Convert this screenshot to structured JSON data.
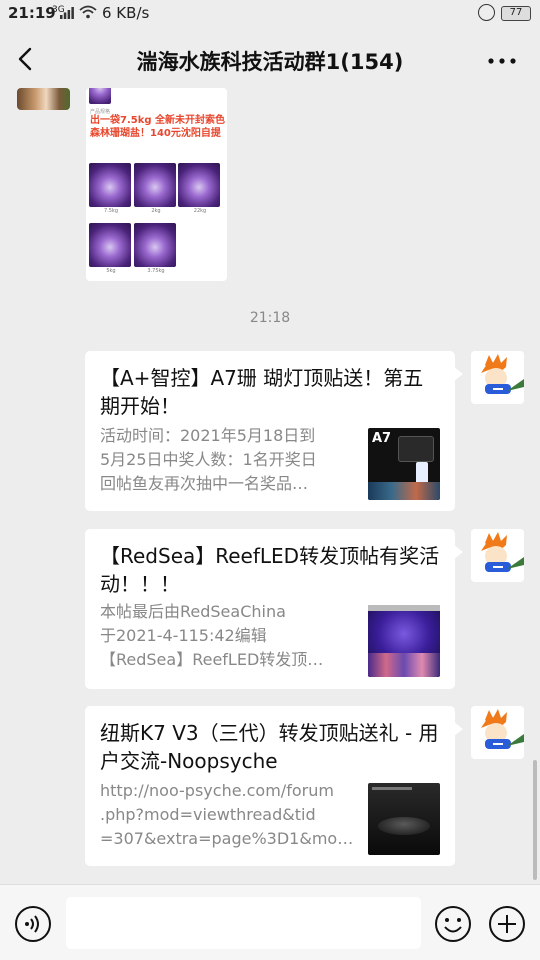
{
  "status_bar": {
    "time": "21:19",
    "network": "3G",
    "speed": "6 KB/s",
    "battery": "77"
  },
  "header": {
    "title": "湍海水族科技活动群1(154)"
  },
  "image_message": {
    "promo_text": "出一袋7.5kg 全新未开封索色森林珊瑚盐！140元沈阳自提",
    "small_text": "产品规格",
    "captions": [
      "7.5kg",
      "2kg",
      "22kg",
      "5kg",
      "3.75kg"
    ]
  },
  "timestamp": "21:18",
  "messages": [
    {
      "title": "【A+智控】A7珊 瑚灯顶贴送！第五期开始！",
      "description": "活动时间：2021年5月18日到\n5月25日中奖人数：1名开奖日\n回帖鱼友再次抽中一名奖品…",
      "thumb_label": "A7"
    },
    {
      "title": "【RedSea】ReefLED转发顶帖有奖活动！！！",
      "description": "本帖最后由RedSeaChina\n于2021-4-115:42编辑\n【RedSea】ReefLED转发顶…"
    },
    {
      "title": "纽斯K7 V3（三代）转发顶贴送礼 - 用户交流-Noopsyche",
      "description": "http://noo-psyche.com/forum\n.php?mod=viewthread&tid\n=307&extra=page%3D1&mo…"
    }
  ],
  "icons": {
    "back": "chevron-left-icon",
    "more": "more-dots-icon",
    "voice": "voice-icon",
    "emoji": "emoji-icon",
    "plus": "plus-icon"
  }
}
